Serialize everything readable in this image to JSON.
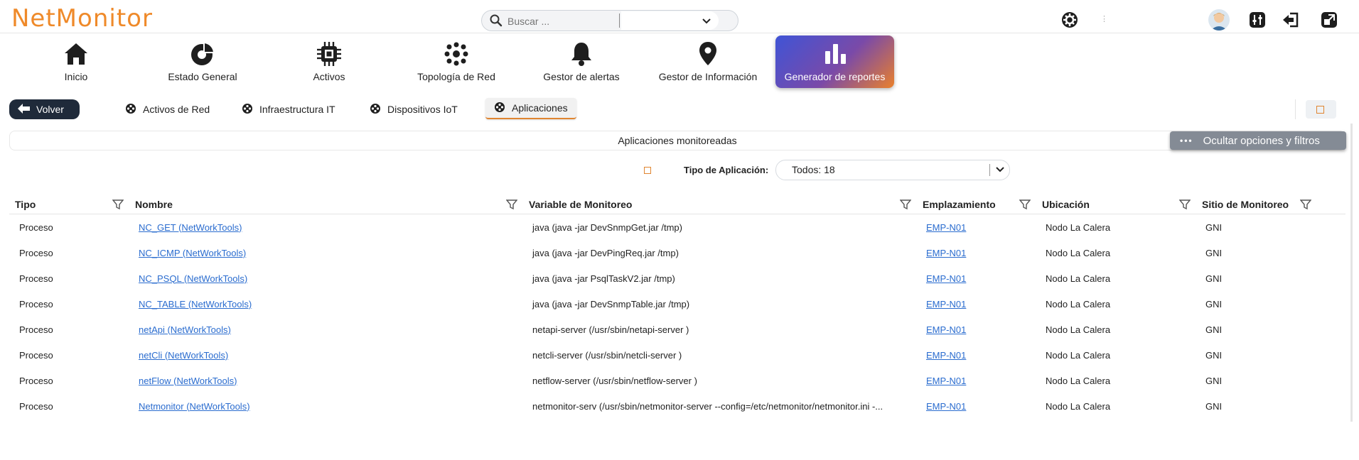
{
  "app": {
    "logo": "NetMonitor"
  },
  "search": {
    "placeholder": "Buscar ..."
  },
  "nav": [
    {
      "label": "Inicio",
      "icon": "home-icon"
    },
    {
      "label": "Estado General",
      "icon": "pie-chart-icon"
    },
    {
      "label": "Activos",
      "icon": "chip-icon"
    },
    {
      "label": "Topología de Red",
      "icon": "network-topology-icon"
    },
    {
      "label": "Gestor de alertas",
      "icon": "bell-icon"
    },
    {
      "label": "Gestor de Información",
      "icon": "map-pin-icon"
    },
    {
      "label": "Generador de reportes",
      "icon": "bar-chart-icon",
      "active": true
    }
  ],
  "subnav": {
    "back_label": "Volver",
    "tabs": [
      "Activos de Red",
      "Infraestructura IT",
      "Dispositivos IoT",
      "Aplicaciones"
    ],
    "active_tab": "Aplicaciones"
  },
  "panel": {
    "title": "Aplicaciones monitoreadas",
    "hide_options_label": "Ocultar opciones y filtros"
  },
  "filter": {
    "label": "Tipo de Aplicación:",
    "value": "Todos: 18"
  },
  "table": {
    "columns": [
      "Tipo",
      "Nombre",
      "Variable de Monitoreo",
      "Emplazamiento",
      "Ubicación",
      "Sitio de Monitoreo"
    ],
    "rows": [
      [
        "Proceso",
        "NC_GET (NetWorkTools)",
        "java (java -jar DevSnmpGet.jar /tmp)",
        "EMP-N01",
        "Nodo La Calera",
        "GNI"
      ],
      [
        "Proceso",
        "NC_ICMP (NetWorkTools)",
        "java (java -jar DevPingReq.jar /tmp)",
        "EMP-N01",
        "Nodo La Calera",
        "GNI"
      ],
      [
        "Proceso",
        "NC_PSQL (NetWorkTools)",
        "java (java -jar PsqlTaskV2.jar /tmp)",
        "EMP-N01",
        "Nodo La Calera",
        "GNI"
      ],
      [
        "Proceso",
        "NC_TABLE (NetWorkTools)",
        "java (java -jar DevSnmpTable.jar /tmp)",
        "EMP-N01",
        "Nodo La Calera",
        "GNI"
      ],
      [
        "Proceso",
        "netApi (NetWorkTools)",
        "netapi-server (/usr/sbin/netapi-server )",
        "EMP-N01",
        "Nodo La Calera",
        "GNI"
      ],
      [
        "Proceso",
        "netCli (NetWorkTools)",
        "netcli-server (/usr/sbin/netcli-server )",
        "EMP-N01",
        "Nodo La Calera",
        "GNI"
      ],
      [
        "Proceso",
        "netFlow (NetWorkTools)",
        "netflow-server (/usr/sbin/netflow-server )",
        "EMP-N01",
        "Nodo La Calera",
        "GNI"
      ],
      [
        "Proceso",
        "Netmonitor (NetWorkTools)",
        "netmonitor-serv (/usr/sbin/netmonitor-server --config=/etc/netmonitor/netmonitor.ini -...",
        "EMP-N01",
        "Nodo La Calera",
        "GNI"
      ]
    ]
  },
  "colors": {
    "brand": "#ef8a2a",
    "link": "#2a6ccf",
    "back_button": "#1f2a3a",
    "hide_button": "#848b95"
  }
}
